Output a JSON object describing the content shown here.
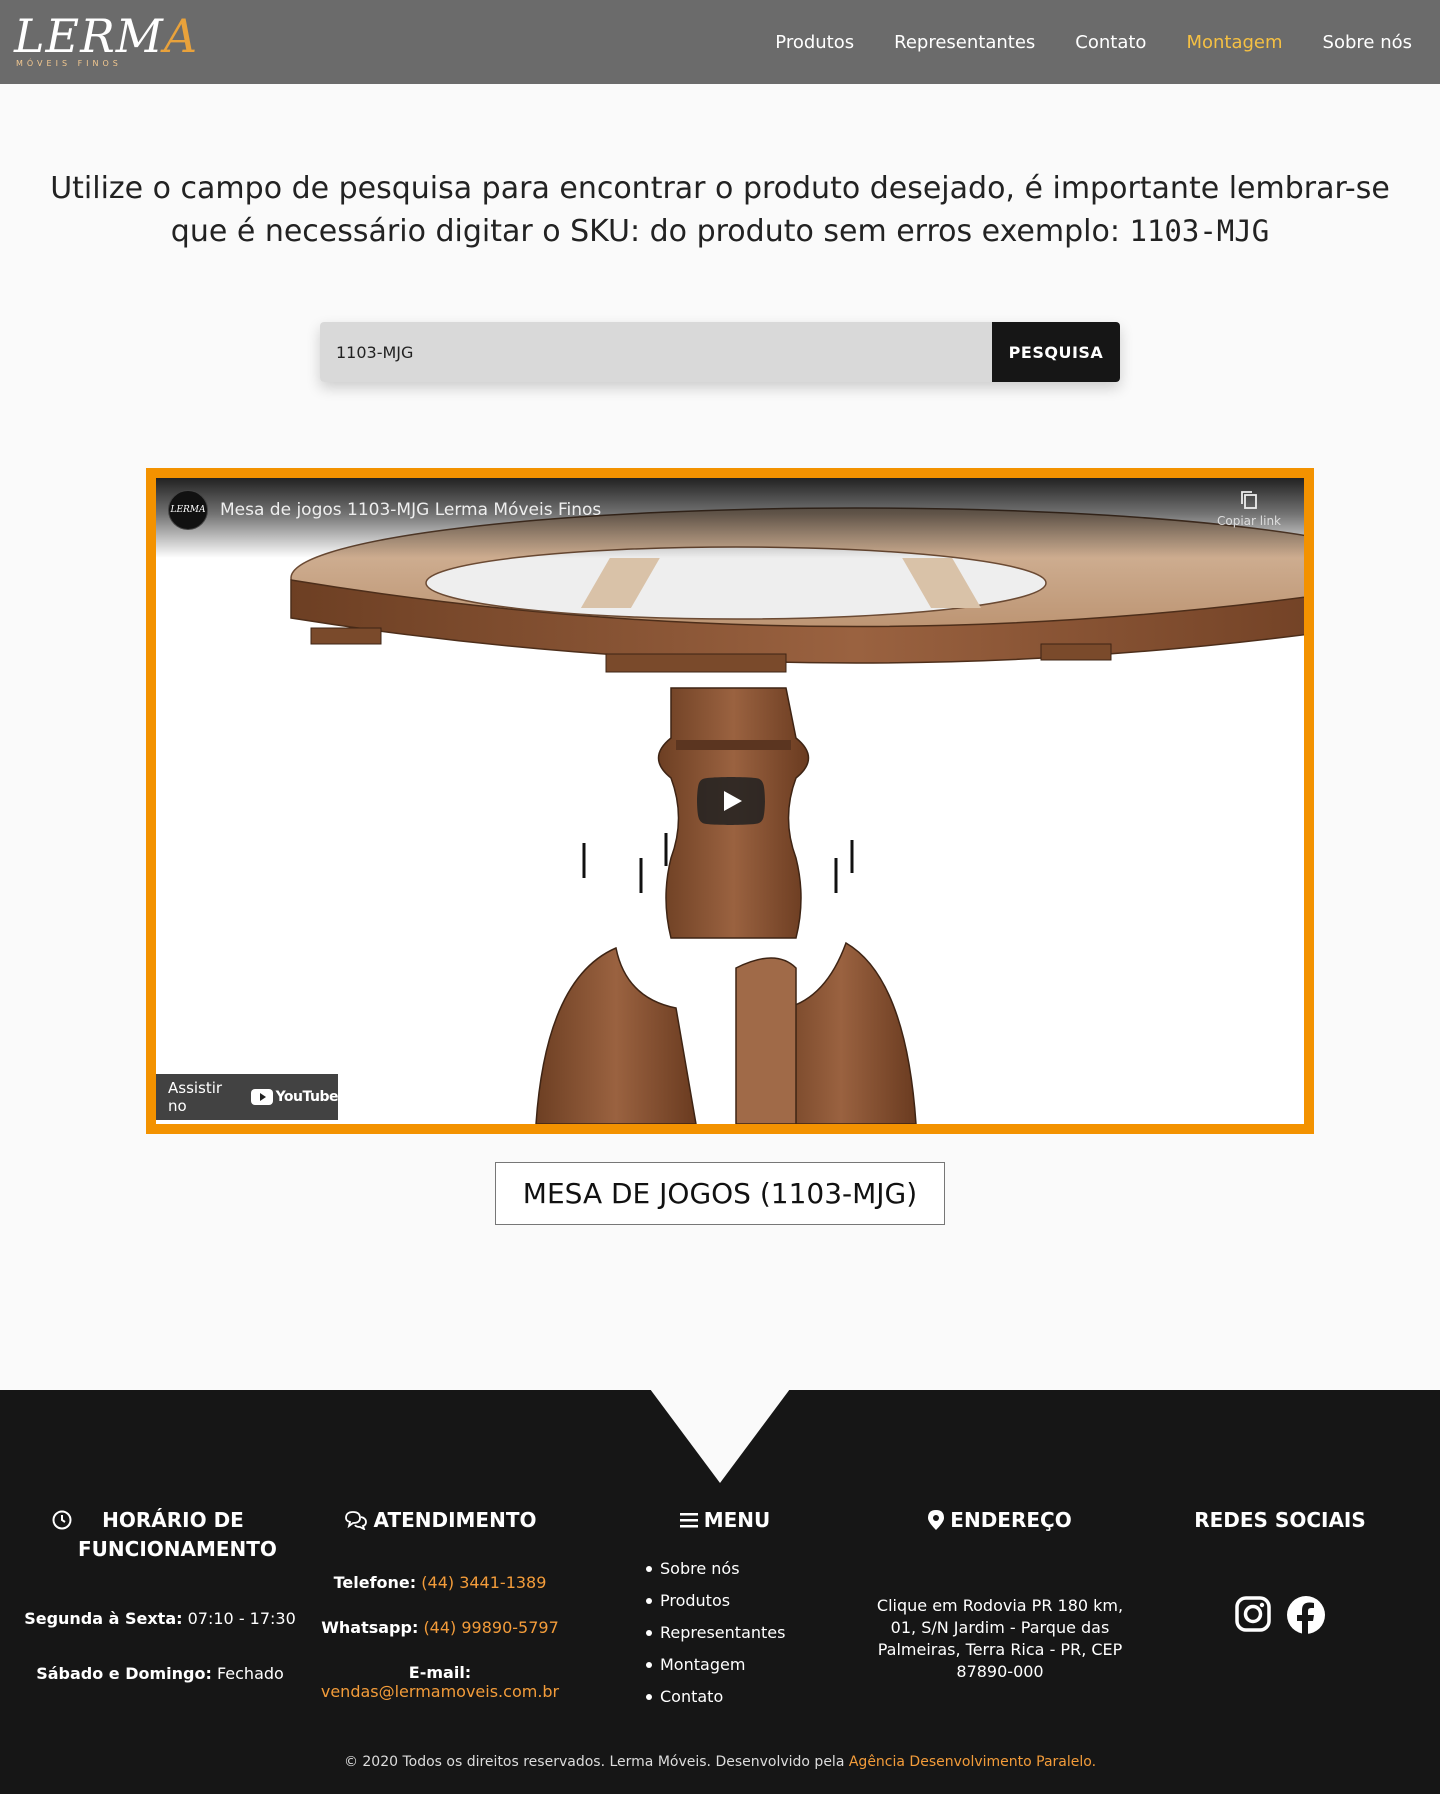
{
  "header": {
    "logo_text": "LERM",
    "logo_accent": "A",
    "logo_subtitle": "MÓVEIS FINOS",
    "nav": [
      {
        "label": "Produtos"
      },
      {
        "label": "Representantes"
      },
      {
        "label": "Contato"
      },
      {
        "label": "Montagem",
        "active": true
      },
      {
        "label": "Sobre nós"
      }
    ]
  },
  "intro": {
    "text": "Utilize o campo de pesquisa para encontrar o produto desejado, é importante lembrar-se que é necessário digitar o SKU: do produto sem erros exemplo:",
    "example_code": "1103-MJG"
  },
  "search": {
    "value": "1103-MJG",
    "button_label": "PESQUISA"
  },
  "video": {
    "channel_logo_text": "LERMA",
    "title": "Mesa de jogos 1103-MJG Lerma Móveis Finos",
    "copy_link_label": "Copiar link",
    "watch_on_label": "Assistir no",
    "youtube_label": "YouTube"
  },
  "product": {
    "title": "MESA DE JOGOS (1103-MJG)"
  },
  "footer": {
    "hours": {
      "heading": "HORÁRIO DE FUNCIONAMENTO",
      "weekday_label": "Segunda à Sexta:",
      "weekday_value": "07:10 - 17:30",
      "weekend_label": "Sábado e Domingo:",
      "weekend_value": "Fechado"
    },
    "service": {
      "heading": "ATENDIMENTO",
      "phone_label": "Telefone:",
      "phone_value": "(44) 3441-1389",
      "whatsapp_label": "Whatsapp:",
      "whatsapp_value": "(44) 99890-5797",
      "email_label": "E-mail:",
      "email_value": "vendas@lermamoveis.com.br"
    },
    "menu": {
      "heading": "MENU",
      "items": [
        "Sobre nós",
        "Produtos",
        "Representantes",
        "Montagem",
        "Contato"
      ]
    },
    "address": {
      "heading": "ENDEREÇO",
      "text": "Clique em Rodovia PR 180 km, 01, S/N Jardim - Parque das Palmeiras, Terra Rica - PR, CEP 87890-000"
    },
    "social": {
      "heading": "REDES SOCIAIS",
      "icons": [
        "instagram-icon",
        "facebook-icon"
      ]
    },
    "copyright": {
      "text": "© 2020 Todos os direitos reservados. Lerma Móveis. Desenvolvido pela",
      "agency": "Agência Desenvolvimento Paralelo",
      "suffix": "."
    }
  },
  "colors": {
    "header_bg": "#6b6b6b",
    "nav_active": "#f5c043",
    "video_border": "#f39200",
    "footer_bg": "#161616",
    "link_orange": "#f39c3a"
  }
}
